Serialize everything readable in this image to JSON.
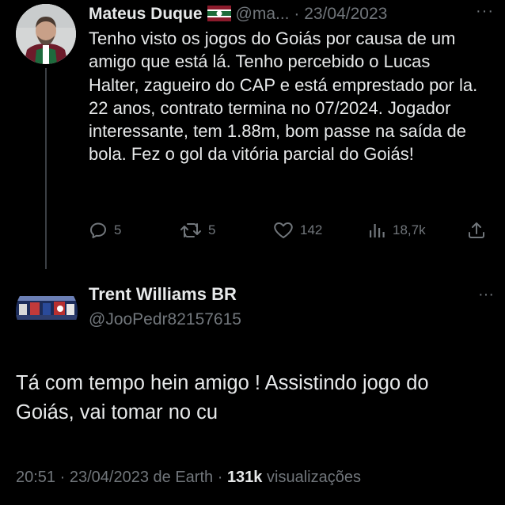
{
  "tweet1": {
    "author_name": "Mateus Duque",
    "handle": "@ma...",
    "separator": "·",
    "date": "23/04/2023",
    "more": "···",
    "text": "Tenho visto os jogos do Goiás por causa de um amigo que está lá. Tenho percebido o Lucas Halter, zagueiro do CAP e está emprestado por la. 22 anos, contrato termina no 07/2024. Jogador interessante, tem 1.88m, bom passe na saída de bola. Fez o gol da vitória parcial do Goiás!",
    "replies": "5",
    "retweets": "5",
    "likes": "142",
    "views": "18,7k",
    "flag_colors": [
      "#8b1a2b",
      "#ffffff",
      "#1d6b3a"
    ]
  },
  "tweet2": {
    "author_name": "Trent Williams BR",
    "handle": "@JooPedr82157615",
    "more": "···",
    "text": "Tá com tempo hein amigo ! Assistindo jogo do Goiás, vai tomar no cu",
    "footer": {
      "time": "20:51",
      "sep1": "·",
      "date": "23/04/2023",
      "via": "de Earth",
      "sep2": "·",
      "views_count": "131k",
      "views_label": "visualizações"
    }
  },
  "colors": {
    "background": "#000000",
    "text": "#e7e9ea",
    "secondary": "#71767b",
    "thread_line": "#3b3f44"
  }
}
